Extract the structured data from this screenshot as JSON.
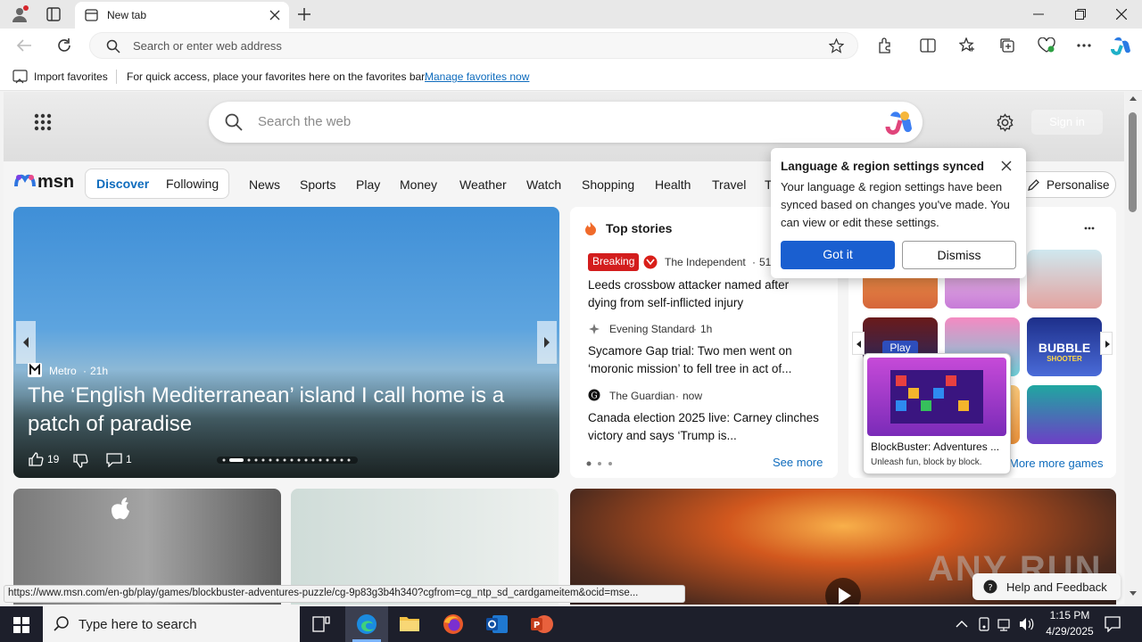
{
  "browser": {
    "tab_title": "New tab",
    "address_placeholder": "Search or enter web address",
    "favorites_bar": {
      "import_label": "Import favorites",
      "hint": "For quick access, place your favorites here on the favorites bar.",
      "manage_link": "Manage favorites now"
    },
    "status_url": "https://www.msn.com/en-gb/play/games/blockbuster-adventures-puzzle/cg-9p83g3b4h340?cgfrom=cg_ntp_sd_cardgameitem&ocid=mse..."
  },
  "msn": {
    "search_placeholder": "Search the web",
    "sign_in": "Sign in",
    "logo_text": "msn",
    "tabs": [
      "Discover",
      "Following"
    ],
    "nav": [
      "News",
      "Sports",
      "Play",
      "Money",
      "Weather",
      "Watch",
      "Shopping",
      "Health",
      "Travel",
      "T"
    ],
    "personalise": "Personalise",
    "hero": {
      "source": "Metro",
      "time": "21h",
      "headline": "The ‘English Mediterranean’ island I call home is a patch of paradise",
      "likes": "19",
      "comments": "1"
    },
    "top_stories": {
      "title": "Top stories",
      "see_more": "See more",
      "items": [
        {
          "badge": "Breaking",
          "source": "The Independent",
          "time": "51m",
          "headline": "Leeds crossbow attacker named after dying from self-inflicted injury"
        },
        {
          "source": "Evening Standard",
          "time": "1h",
          "headline": "Sycamore Gap trial: Two men went on ‘moronic mission’ to fell tree in act of..."
        },
        {
          "source": "The Guardian",
          "time": "now",
          "headline": "Canada election 2025 live: Carney clinches victory and says ‘Trump is..."
        }
      ]
    },
    "games": {
      "play_label": "Play",
      "more": "More more games",
      "tooltip_title": "BlockBuster: Adventures ...",
      "tooltip_sub": "Unleash fun, block by block.",
      "bubble": "BUBBLE",
      "shooter": "SHOOTER"
    },
    "popup": {
      "title": "Language & region settings synced",
      "body": "Your language & region settings have been synced based on changes you've made. You can view or edit these settings.",
      "primary": "Got it",
      "secondary": "Dismiss"
    },
    "help": "Help and Feedback",
    "watermark": "ANY RUN"
  },
  "taskbar": {
    "search_placeholder": "Type here to search",
    "time": "1:15 PM",
    "date": "4/29/2025"
  },
  "colors": {
    "accent": "#0f6cbd",
    "popup_primary": "#1a5fd0",
    "breaking": "#d31d1d",
    "taskbar": "#1d1f2b"
  }
}
